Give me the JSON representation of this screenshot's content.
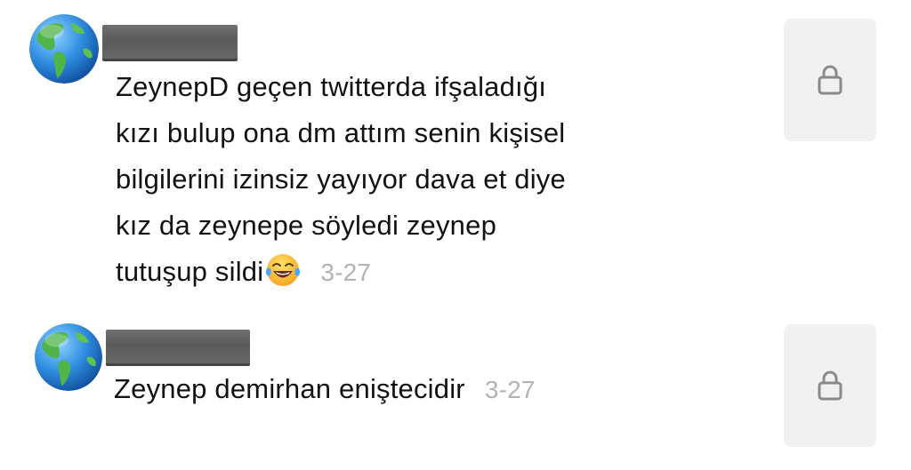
{
  "comments": [
    {
      "text": "ZeynepD geçen twitterda ifşaladığı\nkızı bulup ona dm attım senin kişisel\nbilgilerini izinsiz yayıyor dava et diye\nkız da zeynepe söyledi zeynep\ntutuşup sildi",
      "emoji": "tears-of-joy-emoji",
      "date": "3-27",
      "avatar_icon": "globe-icon",
      "action_icon": "lock-icon"
    },
    {
      "text": "Zeynep demirhan eniştecidir",
      "date": "3-27",
      "avatar_icon": "globe-icon",
      "action_icon": "lock-icon"
    }
  ],
  "colors": {
    "text": "#121212",
    "timestamp": "#b3b3b3",
    "redaction": "#5f5f5f",
    "lock_button_bg": "#f1f1f1",
    "lock_icon": "#8a8a8a"
  }
}
